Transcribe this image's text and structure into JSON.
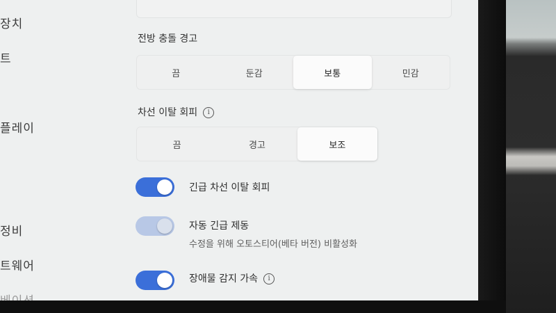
{
  "sidebar": {
    "items": [
      {
        "label": "장치"
      },
      {
        "label": "트"
      },
      {
        "label": "플레이"
      },
      {
        "label": "정비"
      },
      {
        "label": "트웨어"
      },
      {
        "label": "베이션"
      }
    ]
  },
  "forward_collision": {
    "label": "전방 충돌 경고",
    "options": [
      "끔",
      "둔감",
      "보통",
      "민감"
    ],
    "selected": "보통"
  },
  "lane_departure": {
    "label": "차선 이탈 회피",
    "info_icon": "info-icon",
    "options": [
      "끔",
      "경고",
      "보조"
    ],
    "selected": "보조"
  },
  "toggles": {
    "emergency_lane": {
      "label": "긴급 차선 이탈 회피",
      "state": "on"
    },
    "auto_emergency_braking": {
      "label": "자동 긴급 제동",
      "sublabel": "수정을 위해 오토스티어(베타 버전) 비활성화",
      "state": "on-disabled"
    },
    "obstacle_accel": {
      "label": "장애물 감지 가속",
      "info_icon": "info-icon",
      "state": "on"
    }
  },
  "colors": {
    "accent": "#3b6fd9",
    "accent_disabled": "#b8c8e6",
    "screen_bg": "#eef0f0"
  }
}
